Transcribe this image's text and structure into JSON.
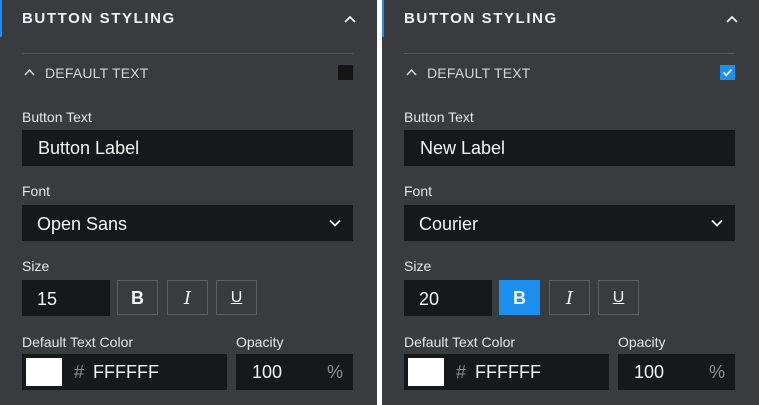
{
  "panels": [
    {
      "header": {
        "title": "BUTTON STYLING"
      },
      "section": {
        "title": "DEFAULT TEXT",
        "checked": false
      },
      "button_text": {
        "label": "Button Text",
        "value": "Button Label"
      },
      "font": {
        "label": "Font",
        "value": "Open Sans"
      },
      "size": {
        "label": "Size",
        "value": "15",
        "bold": "B",
        "italic": "I",
        "underline": "U",
        "bold_active": false
      },
      "color": {
        "label": "Default Text Color",
        "hash": "#",
        "hex": "FFFFFF",
        "swatch": "#FFFFFF"
      },
      "opacity": {
        "label": "Opacity",
        "value": "100",
        "unit": "%"
      }
    },
    {
      "header": {
        "title": "BUTTON STYLING"
      },
      "section": {
        "title": "DEFAULT TEXT",
        "checked": true
      },
      "button_text": {
        "label": "Button Text",
        "value": "New Label"
      },
      "font": {
        "label": "Font",
        "value": "Courier"
      },
      "size": {
        "label": "Size",
        "value": "20",
        "bold": "B",
        "italic": "I",
        "underline": "U",
        "bold_active": true
      },
      "color": {
        "label": "Default Text Color",
        "hash": "#",
        "hex": "FFFFFF",
        "swatch": "#FFFFFF"
      },
      "opacity": {
        "label": "Opacity",
        "value": "100",
        "unit": "%"
      }
    }
  ],
  "colors": {
    "accent": "#1D8FEF",
    "panel_bg": "#3A3B3E",
    "field_bg": "#171819"
  },
  "icons": {
    "collapse": "chevron-up-icon",
    "dropdown": "chevron-down-icon",
    "check": "check-icon"
  }
}
